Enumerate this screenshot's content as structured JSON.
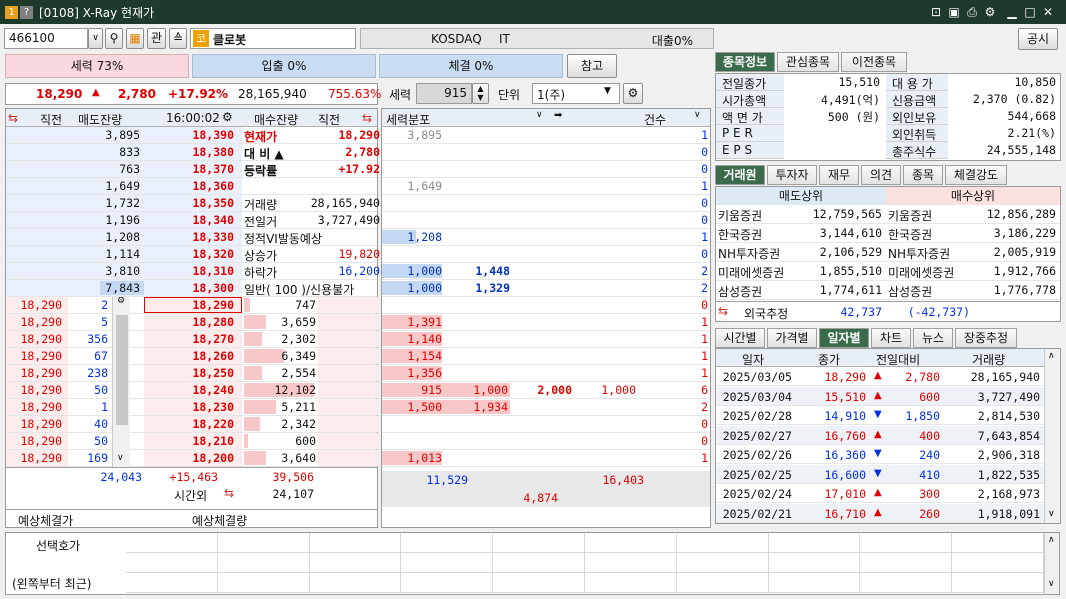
{
  "window": {
    "title": "[0108] X-Ray 현재가",
    "badge1": "1",
    "badge2": "?"
  },
  "toolbar": {
    "code": "466100",
    "hoga": "관",
    "stock_badge": "코",
    "stock_name": "클로봇",
    "market": "KOSDAQ",
    "sector": "IT",
    "loan": "대출0%",
    "notice_btn": "공시",
    "ref_btn": "참고"
  },
  "strength": {
    "power": "세력 73%",
    "inout": "입출 0%",
    "exec": "체결 0%"
  },
  "quote": {
    "price": "18,290",
    "arrow": "▲",
    "change": "2,780",
    "rate": "+17.92%",
    "volume": "28,165,940",
    "turnover": "755.63%"
  },
  "force_ctrl": {
    "label": "세력",
    "value": "915",
    "unit_label": "단위",
    "unit": "1(주)"
  },
  "orderbook": {
    "headers": {
      "prev": "직전",
      "ask_rem": "매도잔량",
      "time": "16:00:02",
      "bid_rem": "매수잔량",
      "prev2": "직전"
    },
    "asks": [
      {
        "qty": "3,895",
        "price": "18,390"
      },
      {
        "qty": "833",
        "price": "18,380"
      },
      {
        "qty": "763",
        "price": "18,370"
      },
      {
        "qty": "1,649",
        "price": "18,360"
      },
      {
        "qty": "1,732",
        "price": "18,350"
      },
      {
        "qty": "1,196",
        "price": "18,340"
      },
      {
        "qty": "1,208",
        "price": "18,330"
      },
      {
        "qty": "1,114",
        "price": "18,320"
      },
      {
        "qty": "3,810",
        "price": "18,310"
      },
      {
        "qty": "7,843",
        "price": "18,300"
      }
    ],
    "info": [
      {
        "k": "현재가",
        "v": "18,290"
      },
      {
        "k": "대 비 ▲",
        "v": "2,780"
      },
      {
        "k": "등락률",
        "v": "+17.92"
      },
      {
        "k": "",
        "v": ""
      },
      {
        "k": "거래량",
        "v": "28,165,940"
      },
      {
        "k": "전일거",
        "v": "3,727,490"
      },
      {
        "k": "정적VI발동예상",
        "v": ""
      },
      {
        "k": "상승가",
        "v": "19,820"
      },
      {
        "k": "하락가",
        "v": "16,200"
      },
      {
        "k": "일반( 100 )/신용불가",
        "v": ""
      }
    ],
    "bids": [
      {
        "price": "18,290",
        "qty": "747"
      },
      {
        "price": "18,280",
        "qty": "3,659"
      },
      {
        "price": "18,270",
        "qty": "2,302"
      },
      {
        "price": "18,260",
        "qty": "6,349"
      },
      {
        "price": "18,250",
        "qty": "2,554"
      },
      {
        "price": "18,240",
        "qty": "12,102"
      },
      {
        "price": "18,230",
        "qty": "5,211"
      },
      {
        "price": "18,220",
        "qty": "2,342"
      },
      {
        "price": "18,210",
        "qty": "600"
      },
      {
        "price": "18,200",
        "qty": "3,640"
      }
    ],
    "ticks": [
      {
        "p": "18,290",
        "q": "2"
      },
      {
        "p": "18,290",
        "q": "5"
      },
      {
        "p": "18,290",
        "q": "356"
      },
      {
        "p": "18,290",
        "q": "67"
      },
      {
        "p": "18,290",
        "q": "238"
      },
      {
        "p": "18,290",
        "q": "50"
      },
      {
        "p": "18,290",
        "q": "1"
      },
      {
        "p": "18,290",
        "q": "40"
      },
      {
        "p": "18,290",
        "q": "50"
      },
      {
        "p": "18,290",
        "q": "169"
      }
    ],
    "totals": {
      "ask_total": "24,043",
      "diff": "+15,463",
      "bid_total": "39,506",
      "after_label": "시간외",
      "after_qty": "24,107"
    },
    "expect": {
      "price_label": "예상체결가",
      "qty_label": "예상체결량"
    }
  },
  "force": {
    "headers": {
      "dist": "세력분포",
      "count": "건수"
    },
    "ask_rows": [
      {
        "a": "3,895",
        "b": "",
        "c": "1"
      },
      {
        "a": "",
        "b": "",
        "c": "0"
      },
      {
        "a": "",
        "b": "",
        "c": "0"
      },
      {
        "a": "1,649",
        "b": "",
        "c": "1"
      },
      {
        "a": "",
        "b": "",
        "c": "0"
      },
      {
        "a": "",
        "b": "",
        "c": "0"
      },
      {
        "a": "1,208",
        "b": "",
        "c": "1"
      },
      {
        "a": "",
        "b": "",
        "c": "0"
      },
      {
        "a": "1,000",
        "b": "1,448",
        "c": "2"
      },
      {
        "a": "1,000",
        "b": "1,329",
        "c": "2"
      }
    ],
    "bid_rows": [
      {
        "a": "",
        "b": "",
        "c": "",
        "d": "",
        "e": "0"
      },
      {
        "a": "1,391",
        "b": "",
        "c": "",
        "d": "",
        "e": "1"
      },
      {
        "a": "1,140",
        "b": "",
        "c": "",
        "d": "",
        "e": "1"
      },
      {
        "a": "1,154",
        "b": "",
        "c": "",
        "d": "",
        "e": "1"
      },
      {
        "a": "1,356",
        "b": "",
        "c": "",
        "d": "",
        "e": "1"
      },
      {
        "a": "915",
        "b": "1,000",
        "c": "2,000",
        "d": "1,000",
        "e": "6"
      },
      {
        "a": "1,500",
        "b": "1,934",
        "c": "",
        "d": "",
        "e": "2"
      },
      {
        "a": "",
        "b": "",
        "c": "",
        "d": "",
        "e": "0"
      },
      {
        "a": "",
        "b": "",
        "c": "",
        "d": "",
        "e": "0"
      },
      {
        "a": "1,013",
        "b": "",
        "c": "",
        "d": "",
        "e": "1"
      }
    ],
    "totals": {
      "ask": "11,529",
      "bid": "16,403",
      "net": "4,874"
    }
  },
  "right_tabs1": [
    "종목정보",
    "관심종목",
    "이전종목"
  ],
  "info": {
    "left": [
      {
        "k": "전일종가",
        "v": "15,510"
      },
      {
        "k": "시가총액",
        "v": "4,491(억)"
      },
      {
        "k": "액 면 가",
        "v": "500 (원)"
      },
      {
        "k": "P E R",
        "v": ""
      },
      {
        "k": "E P S",
        "v": ""
      }
    ],
    "right": [
      {
        "k": "대 용 가",
        "v": "10,850"
      },
      {
        "k": "신용금액",
        "v": "2,370  (0.82)"
      },
      {
        "k": "외인보유",
        "v": "544,668"
      },
      {
        "k": "외인취득",
        "v": "2.21(%)"
      },
      {
        "k": "총주식수",
        "v": "24,555,148"
      }
    ]
  },
  "right_tabs2": [
    "거래원",
    "투자자",
    "재무",
    "의견",
    "종목",
    "체결강도"
  ],
  "broker": {
    "sell_hdr": "매도상위",
    "buy_hdr": "매수상위",
    "rows": [
      {
        "sn": "키움증권",
        "sv": "12,759,565",
        "bn": "키움증권",
        "bv": "12,856,289"
      },
      {
        "sn": "한국증권",
        "sv": "3,144,610",
        "bn": "한국증권",
        "bv": "3,186,229"
      },
      {
        "sn": "NH투자증권",
        "sv": "2,106,529",
        "bn": "NH투자증권",
        "bv": "2,005,919"
      },
      {
        "sn": "미래에셋증권",
        "sv": "1,855,510",
        "bn": "미래에셋증권",
        "bv": "1,912,766"
      },
      {
        "sn": "삼성증권",
        "sv": "1,774,611",
        "bn": "삼성증권",
        "bv": "1,776,778"
      }
    ],
    "foreign_label": "외국추정",
    "foreign_sell": "42,737",
    "foreign_buy": "(-42,737)"
  },
  "right_tabs3": [
    "시간별",
    "가격별",
    "일자별",
    "차트",
    "뉴스",
    "장중추정"
  ],
  "daily": {
    "headers": [
      "일자",
      "종가",
      "전일대비",
      "거래량"
    ],
    "rows": [
      {
        "d": "2025/03/05",
        "c": "18,290",
        "s": "▲",
        "ch": "2,780",
        "v": "28,165,940"
      },
      {
        "d": "2025/03/04",
        "c": "15,510",
        "s": "▲",
        "ch": "600",
        "v": "3,727,490"
      },
      {
        "d": "2025/02/28",
        "c": "14,910",
        "s": "▼",
        "ch": "1,850",
        "v": "2,814,530"
      },
      {
        "d": "2025/02/27",
        "c": "16,760",
        "s": "▲",
        "ch": "400",
        "v": "7,643,854"
      },
      {
        "d": "2025/02/26",
        "c": "16,360",
        "s": "▼",
        "ch": "240",
        "v": "2,906,318"
      },
      {
        "d": "2025/02/25",
        "c": "16,600",
        "s": "▼",
        "ch": "410",
        "v": "1,822,535"
      },
      {
        "d": "2025/02/24",
        "c": "17,010",
        "s": "▲",
        "ch": "300",
        "v": "2,168,973"
      },
      {
        "d": "2025/02/21",
        "c": "16,710",
        "s": "▲",
        "ch": "260",
        "v": "1,918,091"
      }
    ]
  },
  "bottom": {
    "label1": "선택호가",
    "label2": "(왼쪽부터 최근)"
  }
}
